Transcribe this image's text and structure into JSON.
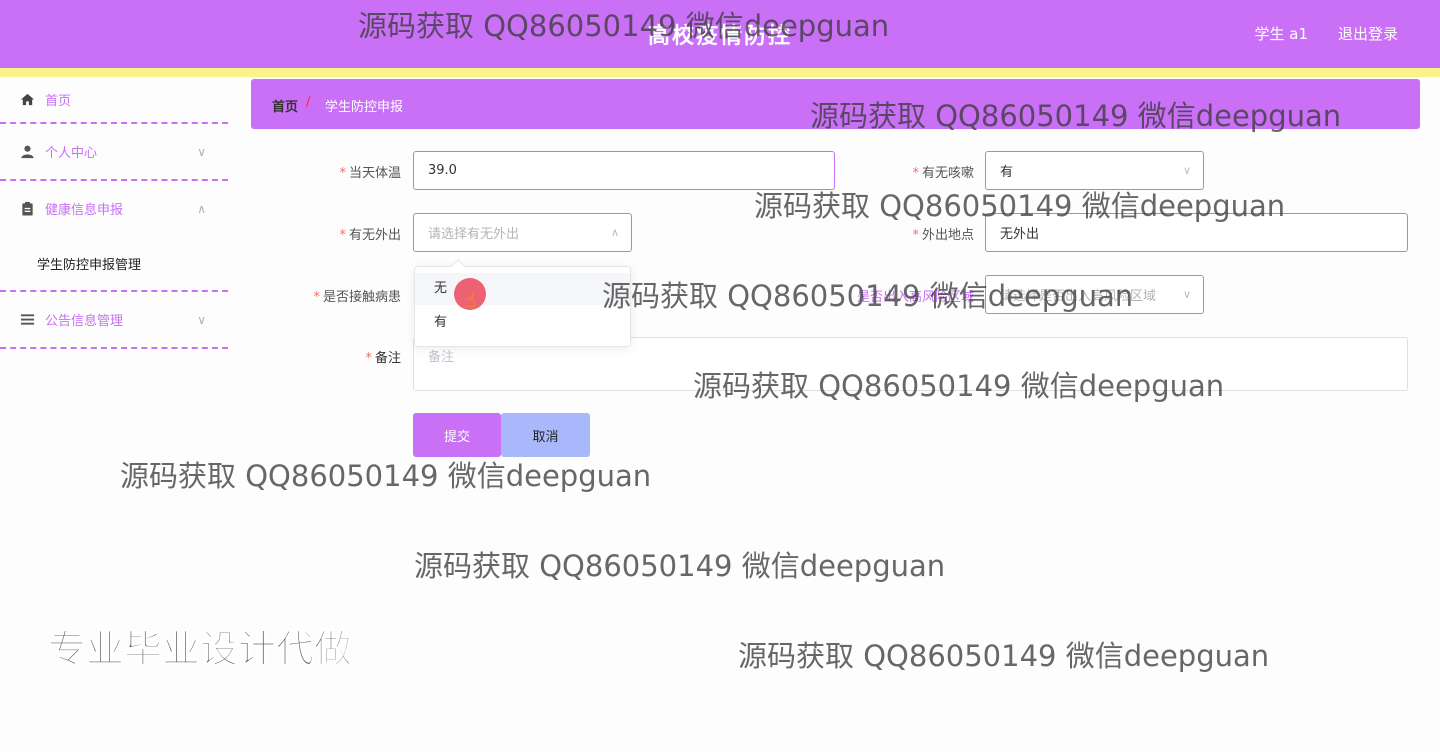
{
  "header": {
    "title": "高校疫情防控",
    "user": "学生 a1",
    "logout": "退出登录"
  },
  "sidebar": {
    "items": [
      {
        "label": "首页",
        "icon": "home-icon"
      },
      {
        "label": "个人中心",
        "icon": "user-icon"
      },
      {
        "label": "健康信息申报",
        "icon": "clipboard-icon",
        "sub": "学生防控申报管理"
      },
      {
        "label": "公告信息管理",
        "icon": "list-icon"
      }
    ]
  },
  "breadcrumb": {
    "home": "首页",
    "separator": "/",
    "current": "学生防控申报"
  },
  "form": {
    "temp_label": "当天体温",
    "temp_value": "39.0",
    "cough_label": "有无咳嗽",
    "cough_value": "有",
    "out_label": "有无外出",
    "out_placeholder": "请选择有无外出",
    "place_label": "外出地点",
    "place_value": "无外出",
    "contact_label": "是否接触病患",
    "risk_label": "是否出入高风险区域",
    "risk_placeholder": "请选择是否出入高风险区域",
    "note_label": "备注",
    "note_placeholder": "备注",
    "required_mark": "*",
    "options": [
      "无",
      "有"
    ],
    "submit": "提交",
    "cancel": "取消"
  },
  "overlay": {
    "watermark": "源码获取 QQ86050149 微信deepguan",
    "promo": "专业毕业设计代做"
  }
}
